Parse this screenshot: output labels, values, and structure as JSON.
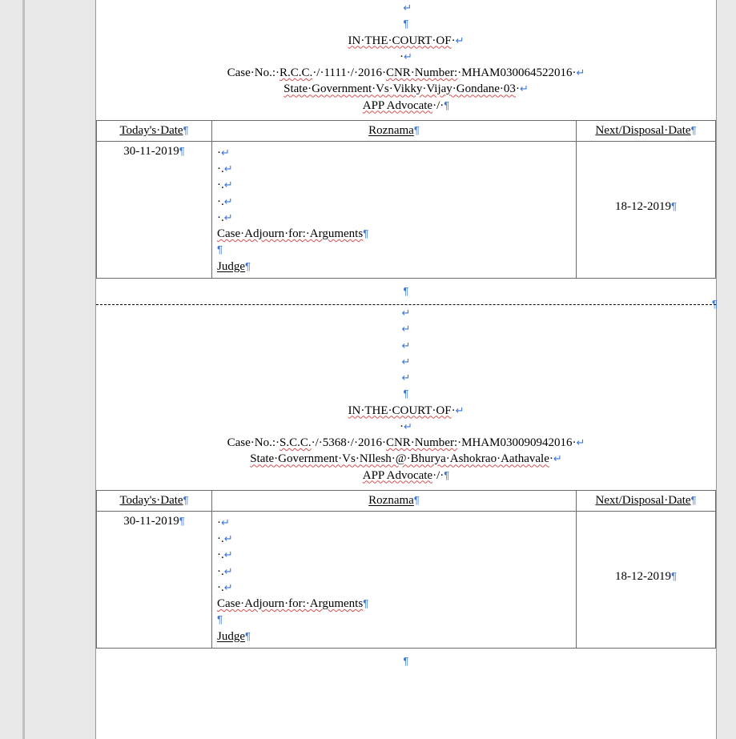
{
  "marks": {
    "pilcrow": "¶",
    "bentarrow": "↵",
    "dot": "·",
    "slashsep": "·/·"
  },
  "labels": {
    "court_of": "IN·THE·COURT·OF",
    "case_no": "Case·No.:",
    "cnr_number": "CNR·Number:",
    "app_advocate": "APP Advocate",
    "todays_date": "Today's·Date",
    "roznama": "Roznama",
    "next_date": "Next/Disposal·Date",
    "judge": "Judge"
  },
  "entries": [
    {
      "case_type": "R.C.C.",
      "case_num": "1111",
      "case_year": "2016",
      "cnr": "MHAM030064522016",
      "parties": "State·Government·Vs·Vikky·Vijay·Gondane·03",
      "advocate_suffix": "·/·",
      "todays_date": "30-11-2019",
      "order_text": "Case·Adjourn·for:·Arguments",
      "next_date": "18-12-2019"
    },
    {
      "case_type": "S.C.C.",
      "case_num": "5368",
      "case_year": "2016",
      "cnr": "MHAM030090942016",
      "parties": "State·Government·Vs·NIlesh·@·Bhurya·Ashokrao·Aathavale",
      "advocate_suffix": "·/·",
      "todays_date": "30-11-2019",
      "order_text": "Case·Adjourn·for:·Arguments",
      "next_date": "18-12-2019"
    }
  ]
}
